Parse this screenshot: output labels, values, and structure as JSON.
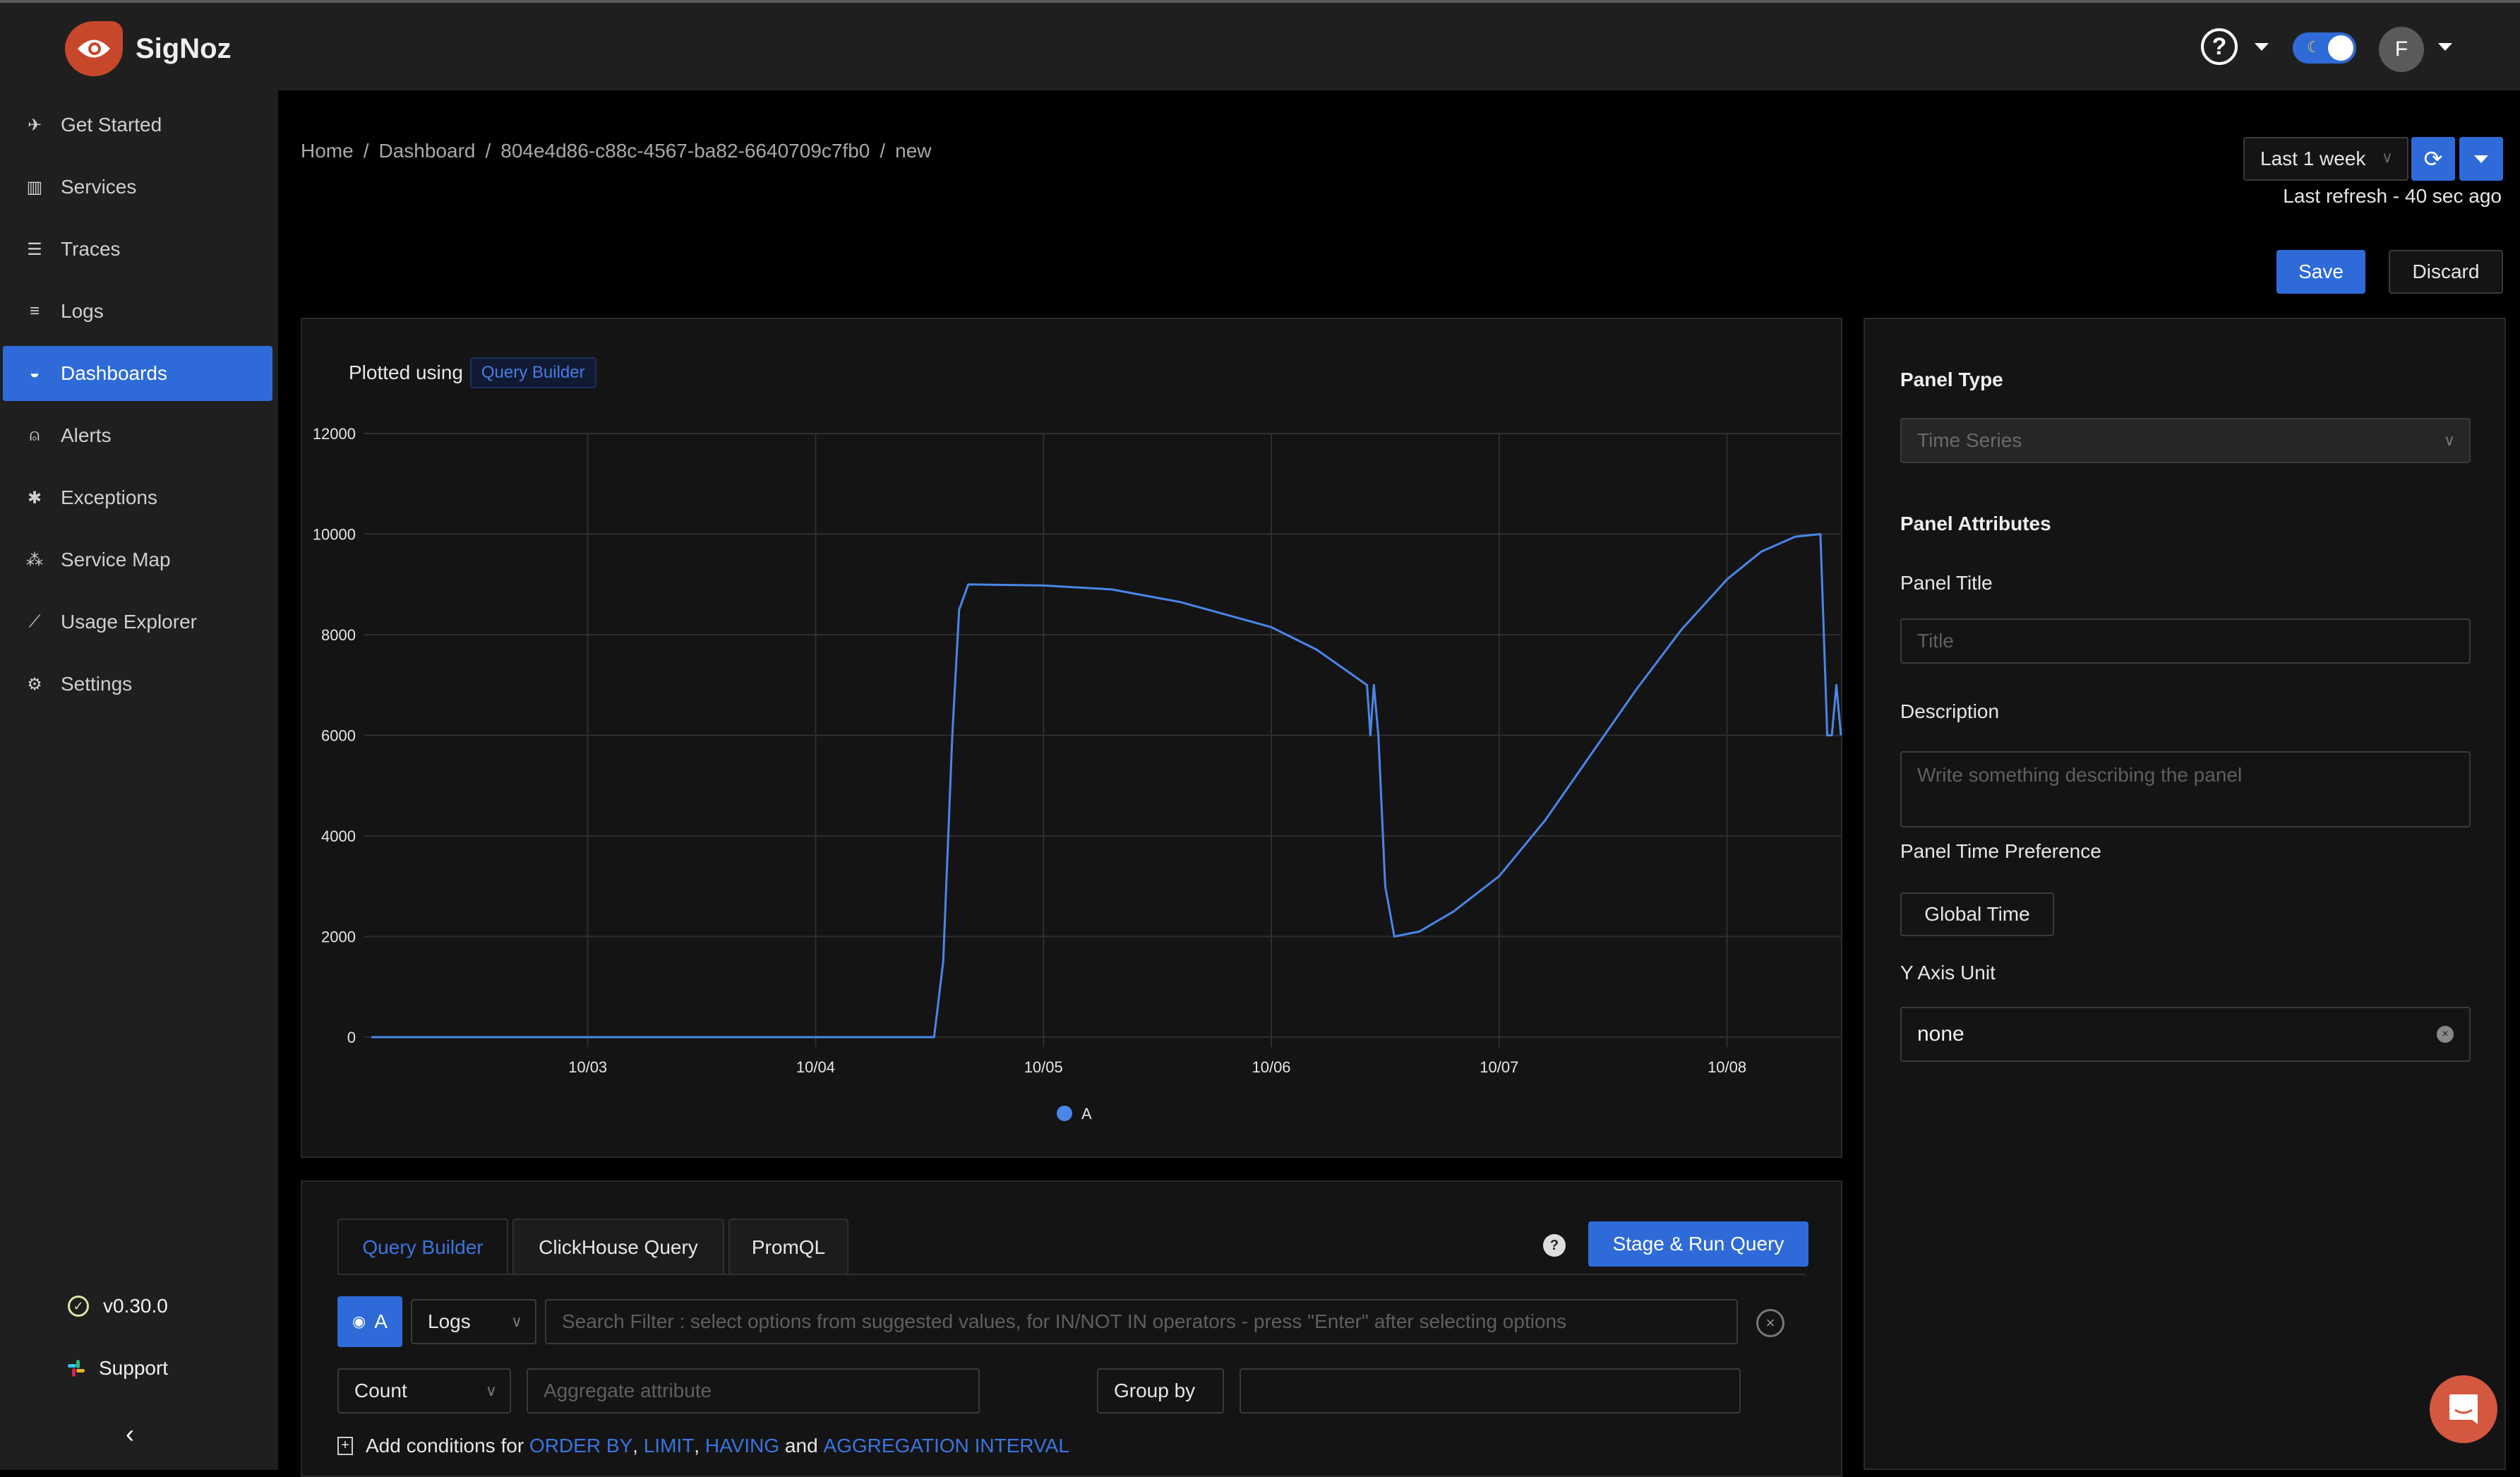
{
  "app": {
    "name": "SigNoz"
  },
  "header": {
    "help_icon": "help-circle-icon",
    "theme_toggle": {
      "icon": "moon-icon",
      "state": "dark"
    },
    "user_avatar_initial": "F"
  },
  "sidebar": {
    "items": [
      {
        "label": "Get Started",
        "icon": "rocket-icon",
        "active": false
      },
      {
        "label": "Services",
        "icon": "bar-chart-icon",
        "active": false
      },
      {
        "label": "Traces",
        "icon": "menu-icon",
        "active": false
      },
      {
        "label": "Logs",
        "icon": "align-left-icon",
        "active": false
      },
      {
        "label": "Dashboards",
        "icon": "dashboard-icon",
        "active": true
      },
      {
        "label": "Alerts",
        "icon": "alert-icon",
        "active": false
      },
      {
        "label": "Exceptions",
        "icon": "bug-icon",
        "active": false
      },
      {
        "label": "Service Map",
        "icon": "deployment-unit-icon",
        "active": false
      },
      {
        "label": "Usage Explorer",
        "icon": "line-chart-icon",
        "active": false
      },
      {
        "label": "Settings",
        "icon": "gear-icon",
        "active": false
      }
    ],
    "version": "v0.30.0",
    "support": "Support",
    "collapse_icon": "chevron-left-icon"
  },
  "breadcrumb": [
    "Home",
    "Dashboard",
    "804e4d86-c88c-4567-ba82-6640709c7fb0",
    "new"
  ],
  "toolbar": {
    "time_range": "Last 1 week",
    "last_refresh": "Last refresh - 40 sec ago",
    "save_label": "Save",
    "discard_label": "Discard"
  },
  "chart_panel": {
    "plotted_using_label": "Plotted using",
    "plotted_using_tag": "Query Builder"
  },
  "chart_data": {
    "type": "line",
    "title": "",
    "xlabel": "",
    "ylabel": "",
    "x_unit": "days since 10/03 00:00",
    "x_ticks": [
      {
        "label": "10/03",
        "x": 0
      },
      {
        "label": "10/04",
        "x": 1
      },
      {
        "label": "10/05",
        "x": 2
      },
      {
        "label": "10/06",
        "x": 3
      },
      {
        "label": "10/07",
        "x": 4
      },
      {
        "label": "10/08",
        "x": 5
      }
    ],
    "xlim": [
      -0.95,
      5.5
    ],
    "ylim": [
      0,
      12000
    ],
    "y_ticks": [
      0,
      2000,
      4000,
      6000,
      8000,
      10000,
      12000
    ],
    "grid": true,
    "legend": "bottom-center",
    "series": [
      {
        "name": "A",
        "color": "#4a86e8",
        "points": [
          [
            -0.95,
            0
          ],
          [
            1.52,
            0
          ],
          [
            1.56,
            1500
          ],
          [
            1.6,
            6000
          ],
          [
            1.63,
            8500
          ],
          [
            1.67,
            9000
          ],
          [
            2.0,
            8980
          ],
          [
            2.3,
            8900
          ],
          [
            2.6,
            8650
          ],
          [
            3.0,
            8150
          ],
          [
            3.2,
            7700
          ],
          [
            3.42,
            7000
          ],
          [
            3.435,
            6000
          ],
          [
            3.45,
            7000
          ],
          [
            3.47,
            6000
          ],
          [
            3.5,
            3000
          ],
          [
            3.54,
            2000
          ],
          [
            3.65,
            2100
          ],
          [
            3.8,
            2500
          ],
          [
            4.0,
            3200
          ],
          [
            4.2,
            4300
          ],
          [
            4.4,
            5600
          ],
          [
            4.6,
            6900
          ],
          [
            4.8,
            8100
          ],
          [
            5.0,
            9100
          ],
          [
            5.15,
            9650
          ],
          [
            5.3,
            9950
          ],
          [
            5.41,
            10000
          ],
          [
            5.425,
            8000
          ],
          [
            5.44,
            6000
          ],
          [
            5.46,
            6000
          ],
          [
            5.48,
            7000
          ],
          [
            5.5,
            6000
          ]
        ]
      }
    ]
  },
  "panel_settings": {
    "panel_type_label": "Panel Type",
    "panel_type_value": "Time Series",
    "attributes_label": "Panel Attributes",
    "title_label": "Panel Title",
    "title_placeholder": "Title",
    "description_label": "Description",
    "description_placeholder": "Write something describing the  panel",
    "time_pref_label": "Panel Time Preference",
    "time_pref_value": "Global Time",
    "y_unit_label": "Y Axis Unit",
    "y_unit_value": "none"
  },
  "query": {
    "tabs": [
      {
        "label": "Query Builder",
        "active": true
      },
      {
        "label": "ClickHouse Query",
        "active": false
      },
      {
        "label": "PromQL",
        "active": false
      }
    ],
    "run_label": "Stage & Run Query",
    "query_name": "A",
    "data_source": "Logs",
    "search_placeholder": "Search Filter : select options from suggested values, for IN/NOT IN operators - press \"Enter\" after selecting options",
    "aggregate_op": "Count",
    "aggregate_placeholder": "Aggregate attribute",
    "group_by_label": "Group by",
    "conditions_prefix": "Add conditions for",
    "conditions_links": [
      "ORDER BY",
      "LIMIT",
      "HAVING",
      "AGGREGATION INTERVAL"
    ],
    "conditions_and": "and"
  },
  "colors": {
    "accent": "#2e6bd8",
    "brand": "#c7472b",
    "series": "#4a86e8"
  }
}
